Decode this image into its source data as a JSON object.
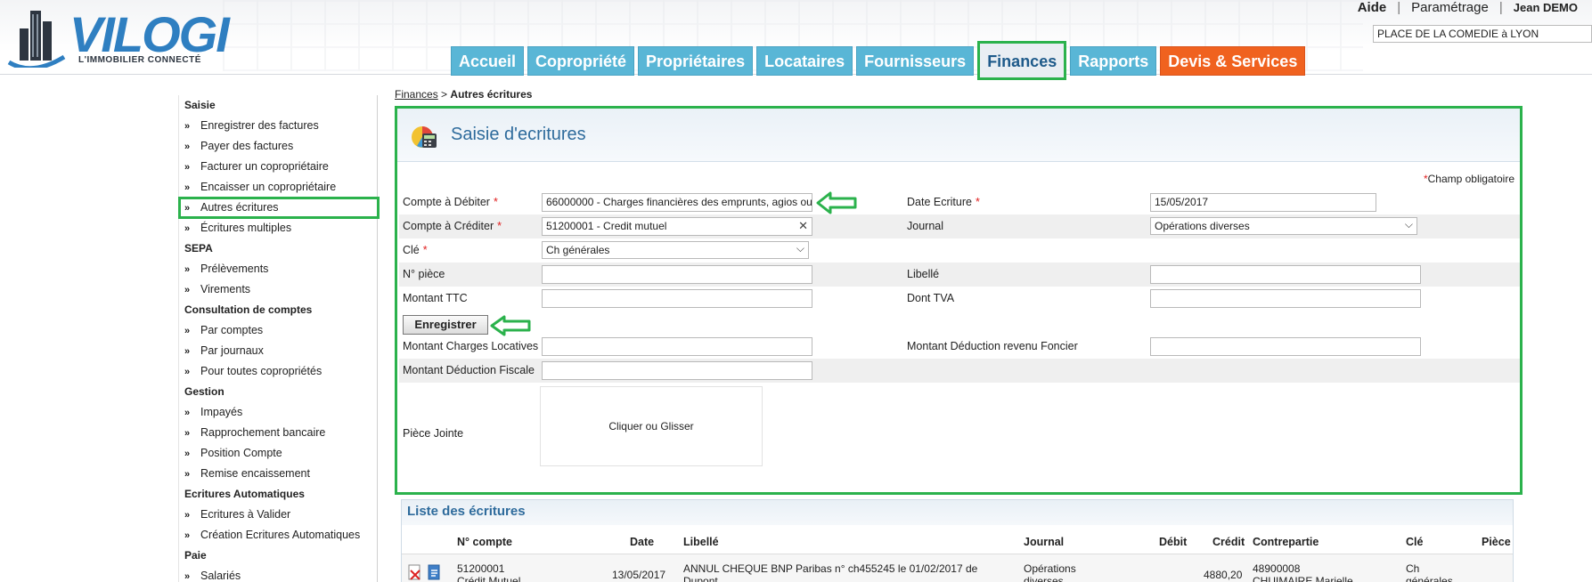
{
  "header": {
    "logo_text": "VILOGI",
    "logo_tagline": "L'IMMOBILIER CONNECTÉ",
    "links": {
      "aide": "Aide",
      "parametrage": "Paramétrage",
      "user": "Jean DEMO"
    },
    "site_select_value": "PLACE DE LA COMEDIE à LYON",
    "nav_tabs": [
      {
        "label": "Accueil"
      },
      {
        "label": "Copropriété"
      },
      {
        "label": "Propriétaires"
      },
      {
        "label": "Locataires"
      },
      {
        "label": "Fournisseurs"
      },
      {
        "label": "Finances"
      },
      {
        "label": "Rapports"
      },
      {
        "label": "Devis & Services"
      }
    ]
  },
  "sidebar": {
    "sections": [
      {
        "title": "Saisie",
        "items": [
          "Enregistrer des factures",
          "Payer des factures",
          "Facturer un copropriétaire",
          "Encaisser un copropriétaire",
          "Autres écritures",
          "Écritures multiples"
        ]
      },
      {
        "title": "SEPA",
        "items": [
          "Prélèvements",
          "Virements"
        ]
      },
      {
        "title": "Consultation de comptes",
        "items": [
          "Par comptes",
          "Par journaux",
          "Pour toutes copropriétés"
        ]
      },
      {
        "title": "Gestion",
        "items": [
          "Impayés",
          "Rapprochement bancaire",
          "Position Compte",
          "Remise encaissement"
        ]
      },
      {
        "title": "Ecritures Automatiques",
        "items": [
          "Ecritures à Valider",
          "Création Ecritures Automatiques"
        ]
      },
      {
        "title": "Paie",
        "items": [
          "Salariés"
        ]
      }
    ]
  },
  "breadcrumb": {
    "parent": "Finances",
    "separator": ">",
    "current": "Autres écritures"
  },
  "form": {
    "title": "Saisie d'ecritures",
    "required_note": "Champ obligatoire",
    "required_star": "*",
    "compte_debiter_label": "Compte à Débiter",
    "compte_debiter_value": "66000000 - Charges financières des emprunts, agios ou",
    "compte_crediter_label": "Compte à Créditer",
    "compte_crediter_value": "51200001 - Credit mutuel",
    "cle_label": "Clé",
    "cle_value": "Ch générales",
    "piece_label": "N° pièce",
    "montant_ttc_label": "Montant TTC",
    "date_label": "Date Ecriture",
    "date_value": "15/05/2017",
    "journal_label": "Journal",
    "journal_value": "Opérations diverses",
    "libelle_label": "Libellé",
    "tva_label": "Dont TVA",
    "save_label": "Enregistrer",
    "charges_locatives_label": "Montant Charges Locatives",
    "deduction_fiscale_label": "Montant Déduction Fiscale",
    "deduction_foncier_label": "Montant Déduction revenu Foncier",
    "piece_jointe_label": "Pièce Jointe",
    "dropzone_text": "Cliquer ou Glisser"
  },
  "list": {
    "title": "Liste des écritures",
    "columns": [
      "N° compte",
      "Date",
      "Libellé",
      "Journal",
      "Débit",
      "Crédit",
      "Contrepartie",
      "Clé",
      "Pièce"
    ],
    "rows": [
      {
        "compte": "51200001",
        "compte2": "Crédit Mutuel",
        "date": "13/05/2017",
        "libelle": "ANNUL CHEQUE BNP Paribas n° ch455245 le 01/02/2017 de",
        "libelle2": "Dupont",
        "journal": "Opérations",
        "journal2": "diverses",
        "debit": "",
        "credit": "4880,20",
        "contrepartie": "48900008",
        "contrepartie2": "CHUIMAIRE Marielle",
        "cle": "Ch",
        "cle2": "générales"
      }
    ]
  },
  "colors": {
    "accent_green": "#2bb24c",
    "nav_blue": "#59b6d6",
    "nav_orange": "#f0621f",
    "title_blue": "#2e6b9c"
  }
}
